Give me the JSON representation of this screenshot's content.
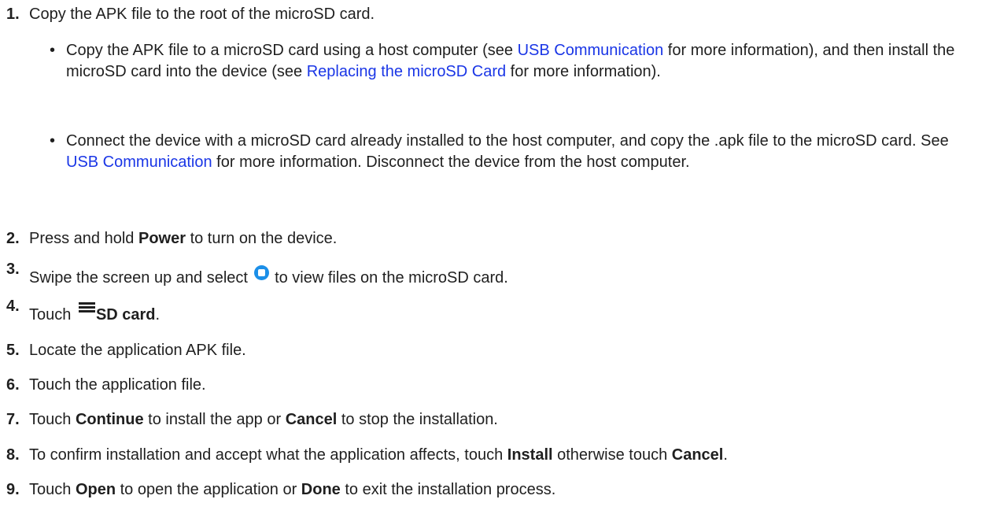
{
  "steps": [
    {
      "number": "1.",
      "text": "Copy the APK file to the root of the microSD card.",
      "sub_items": [
        {
          "bullet": "•",
          "t1": "Copy the APK file to a microSD card using a host computer (see ",
          "l1": "USB Communication",
          "t2": " for more information), and then install the microSD card into the device (see ",
          "l2": "Replacing the microSD Card",
          "t3": " for more information)."
        },
        {
          "bullet": "•",
          "t1": "Connect the device with a microSD card already installed to the host computer, and copy the .apk file to the microSD card. See ",
          "l1": "USB Communication",
          "t2": " for more information. Disconnect the device from the host computer."
        }
      ]
    },
    {
      "number": "2.",
      "pre": "Press and hold ",
      "bold": "Power",
      "post": " to turn on the device."
    },
    {
      "number": "3.",
      "pre": "Swipe the screen up and select ",
      "icon": "files-app-icon",
      "post": " to view files on the microSD card."
    },
    {
      "number": "4.",
      "pre": "Touch ",
      "icon": "menu-icon",
      "bold": "SD card",
      "post": "."
    },
    {
      "number": "5.",
      "text": "Locate the application APK file."
    },
    {
      "number": "6.",
      "text": "Touch the application file."
    },
    {
      "number": "7.",
      "pre": "Touch ",
      "bold1": "Continue",
      "mid": " to install the app or ",
      "bold2": "Cancel",
      "post": " to stop the installation."
    },
    {
      "number": "8.",
      "pre": "To confirm installation and accept what the application affects, touch ",
      "bold1": "Install",
      "mid": " otherwise touch ",
      "bold2": "Cancel",
      "post": "."
    },
    {
      "number": "9.",
      "pre": "Touch ",
      "bold1": "Open",
      "mid": " to open the application or ",
      "bold2": "Done",
      "post": " to exit the installation process."
    }
  ],
  "colors": {
    "link": "#1a36e6",
    "text": "#1f1f1f",
    "files_icon": "#1b8fe8"
  }
}
